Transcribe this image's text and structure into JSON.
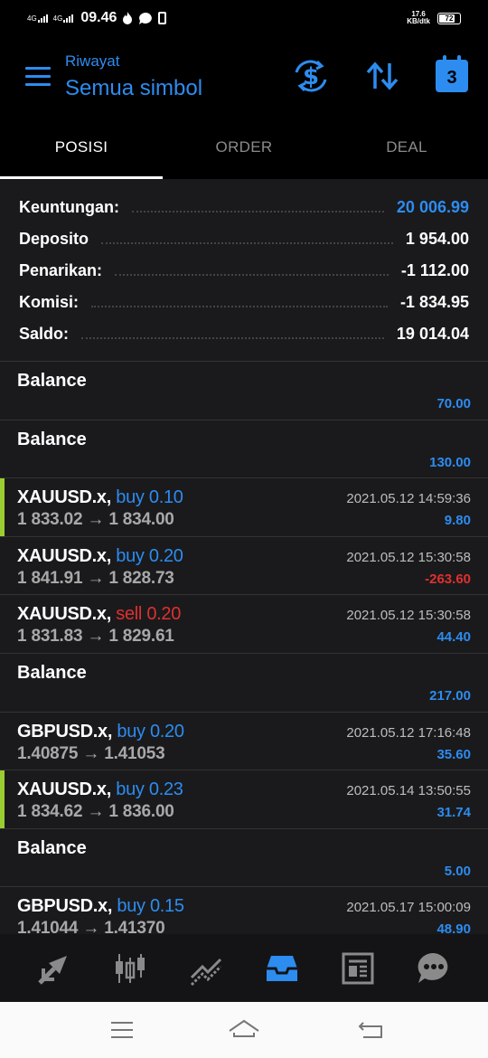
{
  "status_bar": {
    "network1": "4G",
    "network2": "4G",
    "time": "09.46",
    "speed_value": "17.6",
    "speed_unit": "KB/dtk",
    "battery": "72"
  },
  "header": {
    "subtitle": "Riwayat",
    "title": "Semua simbol",
    "calendar_day": "3"
  },
  "tabs": [
    {
      "label": "POSISI",
      "active": true
    },
    {
      "label": "ORDER",
      "active": false
    },
    {
      "label": "DEAL",
      "active": false
    }
  ],
  "summary": [
    {
      "label": "Keuntungan:",
      "value": "20 006.99"
    },
    {
      "label": "Deposito",
      "value": "1 954.00"
    },
    {
      "label": "Penarikan:",
      "value": "-1 112.00"
    },
    {
      "label": "Komisi:",
      "value": "-1 834.95"
    },
    {
      "label": "Saldo:",
      "value": "19 014.04"
    }
  ],
  "items": [
    {
      "type": "balance",
      "title": "Balance",
      "amount": "70.00"
    },
    {
      "type": "balance",
      "title": "Balance",
      "amount": "130.00"
    },
    {
      "type": "trade",
      "symbol": "XAUUSD.x,",
      "side": "buy 0.10",
      "prices": "1 833.02 → 1 834.00",
      "time": "2021.05.12 14:59:36",
      "amount": "9.80"
    },
    {
      "type": "trade",
      "symbol": "XAUUSD.x,",
      "side": "buy 0.20",
      "prices": "1 841.91 → 1 828.73",
      "time": "2021.05.12 15:30:58",
      "amount": "-263.60"
    },
    {
      "type": "trade",
      "symbol": "XAUUSD.x,",
      "side": "sell 0.20",
      "prices": "1 831.83 → 1 829.61",
      "time": "2021.05.12 15:30:58",
      "amount": "44.40"
    },
    {
      "type": "balance",
      "title": "Balance",
      "amount": "217.00"
    },
    {
      "type": "trade",
      "symbol": "GBPUSD.x,",
      "side": "buy 0.20",
      "prices": "1.40875 → 1.41053",
      "time": "2021.05.12 17:16:48",
      "amount": "35.60"
    },
    {
      "type": "trade",
      "symbol": "XAUUSD.x,",
      "side": "buy 0.23",
      "prices": "1 834.62 → 1 836.00",
      "time": "2021.05.14 13:50:55",
      "amount": "31.74"
    },
    {
      "type": "balance",
      "title": "Balance",
      "amount": "5.00"
    },
    {
      "type": "trade",
      "symbol": "GBPUSD.x,",
      "side": "buy 0.15",
      "prices": "1.41044 → 1.41370",
      "time": "2021.05.17 15:00:09",
      "amount": "48.90"
    }
  ],
  "bottom_nav": [
    {
      "icon": "quotes-icon",
      "active": false
    },
    {
      "icon": "chart-icon",
      "active": false
    },
    {
      "icon": "trade-icon",
      "active": false
    },
    {
      "icon": "history-icon",
      "active": true
    },
    {
      "icon": "news-icon",
      "active": false
    },
    {
      "icon": "chat-icon",
      "active": false
    }
  ],
  "colors": {
    "accent": "#2d8cf0",
    "loss": "#e03030",
    "highlight_bar": "#9acd32",
    "background": "#1a1a1c"
  }
}
